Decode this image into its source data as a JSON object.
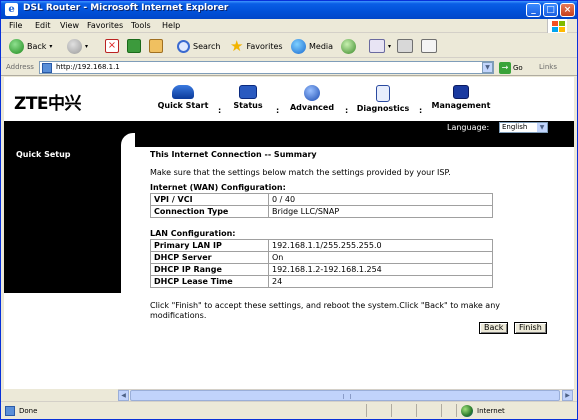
{
  "window": {
    "title": "DSL Router - Microsoft Internet Explorer",
    "icon_name": "ie-icon",
    "controls": [
      "minimize",
      "maximize",
      "close"
    ]
  },
  "menu": [
    "File",
    "Edit",
    "View",
    "Favorites",
    "Tools",
    "Help"
  ],
  "toolbar": {
    "back": "Back",
    "search": "Search",
    "favorites": "Favorites",
    "media": "Media"
  },
  "address": {
    "label": "Address",
    "url": "http://192.168.1.1",
    "go": "Go",
    "links": "Links"
  },
  "router": {
    "brand": "ZTE中兴",
    "nav": [
      "Quick Start",
      "Status",
      "Advanced",
      "Diagnostics",
      "Management"
    ],
    "language_label": "Language:",
    "language_value": "English",
    "sidebar": [
      "Quick Setup"
    ]
  },
  "summary": {
    "title": "This Internet Connection -- Summary",
    "intro": "Make sure that the settings below match the settings provided by your ISP.",
    "wan_label": "Internet (WAN) Configuration:",
    "wan_rows": [
      {
        "key": "VPI / VCI",
        "value": "0 / 40"
      },
      {
        "key": "Connection Type",
        "value": "Bridge LLC/SNAP"
      }
    ],
    "lan_label": "LAN Configuration:",
    "lan_rows": [
      {
        "key": "Primary LAN IP",
        "value": "192.168.1.1/255.255.255.0"
      },
      {
        "key": "DHCP Server",
        "value": "On"
      },
      {
        "key": "DHCP IP Range",
        "value": "192.168.1.2-192.168.1.254"
      },
      {
        "key": "DHCP Lease Time",
        "value": "24"
      }
    ],
    "note": "Click \"Finish\" to accept these settings, and reboot the system.Click \"Back\" to make any modifications.",
    "back_button": "Back",
    "finish_button": "Finish"
  },
  "status": {
    "left": "Done",
    "zone": "Internet"
  }
}
